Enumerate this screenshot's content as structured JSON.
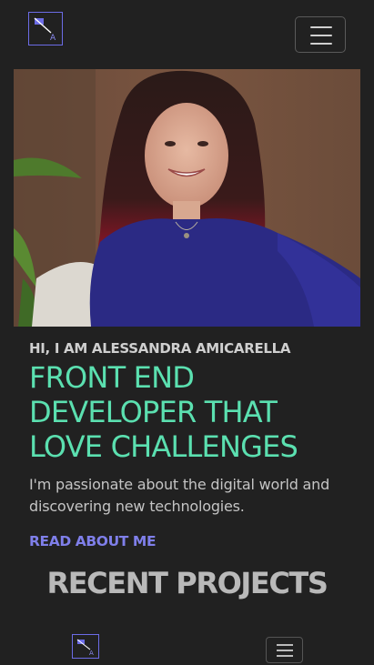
{
  "navbar": {
    "logo_letter": "A",
    "menu_icon": "hamburger-menu-icon",
    "accent": "#6c6ce6"
  },
  "hero": {
    "photo_alt": "portrait photo",
    "greeting": "HI, I AM ALESSANDRA AMICARELLA",
    "headline_lines": [
      "FRONT END",
      "DEVELOPER THAT",
      "LOVE CHALLENGES"
    ],
    "intro": "I'm passionate about the digital world and discovering new technologies.",
    "cta_label": "READ ABOUT ME",
    "headline_color": "#5be0b0",
    "cta_color": "#7f7fea"
  },
  "projects": {
    "title": "RECENT PROJECTS"
  },
  "sticky_nav": {
    "logo_letter": "A",
    "menu_icon": "hamburger-menu-icon"
  }
}
